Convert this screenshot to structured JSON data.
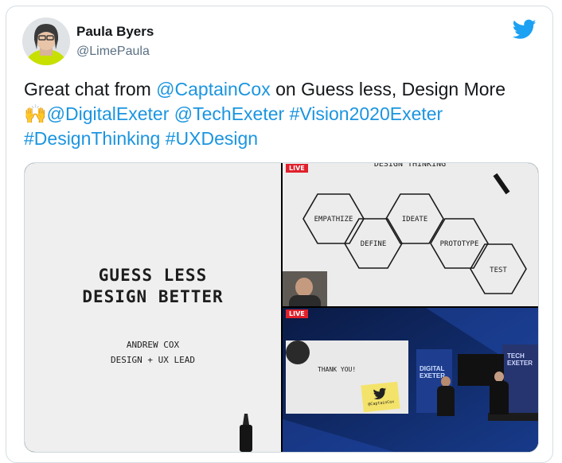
{
  "tweet": {
    "author_name": "Paula Byers",
    "author_handle": "@LimePaula",
    "icons": {
      "avatar": "profile-photo",
      "logo": "twitter-bird-icon",
      "emoji": "raising-hands-emoji"
    },
    "text": {
      "line1_prefix": "Great chat from ",
      "mention_captaincox": "@CaptainCox",
      "line1_suffix": " on Guess less, Design More",
      "emoji": "🙌",
      "mention_digitalexeter": "@DigitalExeter",
      "mention_techexeter": "@TechExeter",
      "hashtag_vision": "#Vision2020Exeter",
      "hashtag_designthinking": "#DesignThinking",
      "hashtag_uxdesign": "#UXDesign"
    }
  },
  "media": {
    "left_panel": {
      "title_line1": "GUESS LESS",
      "title_line2": "DESIGN BETTER",
      "subtitle_line1": "ANDREW COX",
      "subtitle_line2": "DESIGN + UX LEAD"
    },
    "top_right_panel": {
      "live_badge": "LIVE",
      "heading": "DESIGN THINKING",
      "hexagons": [
        "EMPATHIZE",
        "DEFINE",
        "IDEATE",
        "PROTOTYPE",
        "TEST"
      ]
    },
    "bottom_right_panel": {
      "live_badge": "LIVE",
      "note_text": "THANK YOU!",
      "sticky_handle": "@CaptainCox",
      "screen_text_left": "DIGITAL EXETER",
      "screen_text_right": "TECH EXETER"
    }
  },
  "colors": {
    "link": "#1b95e0",
    "twitter_blue": "#1da1f2",
    "live_red": "#e0202b"
  }
}
